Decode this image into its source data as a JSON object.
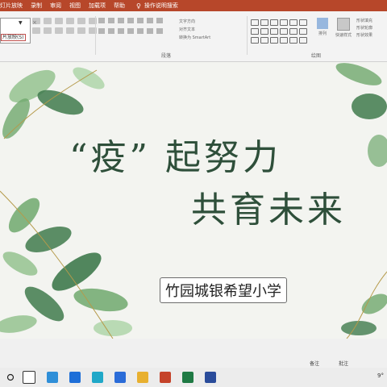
{
  "menubar": {
    "items": [
      "灯片放映",
      "录制",
      "审阅",
      "视图",
      "加载项",
      "帮助"
    ],
    "search_placeholder": "操作说明搜索"
  },
  "ribbon": {
    "style_text": "片放映(S)",
    "paragraph_group": "段落",
    "drawing_group": "绘图",
    "direction_labels": [
      "文字方向",
      "对齐文本",
      "转换为 SmartArt"
    ],
    "arrange_label": "排列",
    "quick_style_label": "快速样式",
    "fill_labels": [
      "形状填充",
      "形状轮廓",
      "形状效果"
    ]
  },
  "slide": {
    "title_line1": "“疫” 起努力",
    "title_line2": "共育未来",
    "school": "竹园城银希望小学"
  },
  "statusbar": {
    "notes": "备注",
    "comments": "批注"
  },
  "taskbar": {
    "tray_text": "9°"
  },
  "colors": {
    "accent": "#b7472a",
    "title": "#2e4f3a",
    "leaf_dark": "#3f7a4c",
    "leaf_light": "#8fbf8a"
  }
}
